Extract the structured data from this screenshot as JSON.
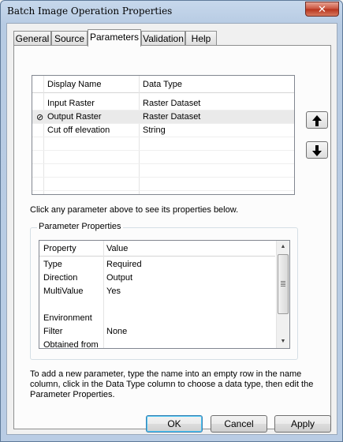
{
  "window": {
    "title": "Batch Image Operation Properties"
  },
  "tabs": [
    {
      "label": "General"
    },
    {
      "label": "Source"
    },
    {
      "label": "Parameters"
    },
    {
      "label": "Validation"
    },
    {
      "label": "Help"
    }
  ],
  "parameters_grid": {
    "columns": [
      "Display Name",
      "Data Type"
    ],
    "rows": [
      {
        "name": "Input Raster",
        "type": "Raster Dataset"
      },
      {
        "name": "Output Raster",
        "type": "Raster Dataset",
        "marker": "⊘"
      },
      {
        "name": "Cut off elevation",
        "type": "String"
      }
    ]
  },
  "hint": "Click any parameter above to see its properties below.",
  "param_props": {
    "group_title": "Parameter Properties",
    "columns": [
      "Property",
      "Value"
    ],
    "rows": [
      {
        "property": "Type",
        "value": "Required"
      },
      {
        "property": "Direction",
        "value": "Output"
      },
      {
        "property": "MultiValue",
        "value": "Yes"
      },
      {
        "property": "",
        "value": ""
      },
      {
        "property": "Environment",
        "value": ""
      },
      {
        "property": "Filter",
        "value": "None"
      },
      {
        "property": "Obtained from",
        "value": ""
      }
    ]
  },
  "footnote": "To add a new parameter, type the name into an empty row in the name column, click in the Data Type column to choose a data type, then edit the Parameter Properties.",
  "buttons": {
    "ok": "OK",
    "cancel": "Cancel",
    "apply": "Apply"
  },
  "icons": {
    "move_up": "arrow-up-icon",
    "move_down": "arrow-down-icon",
    "close": "close-icon"
  }
}
